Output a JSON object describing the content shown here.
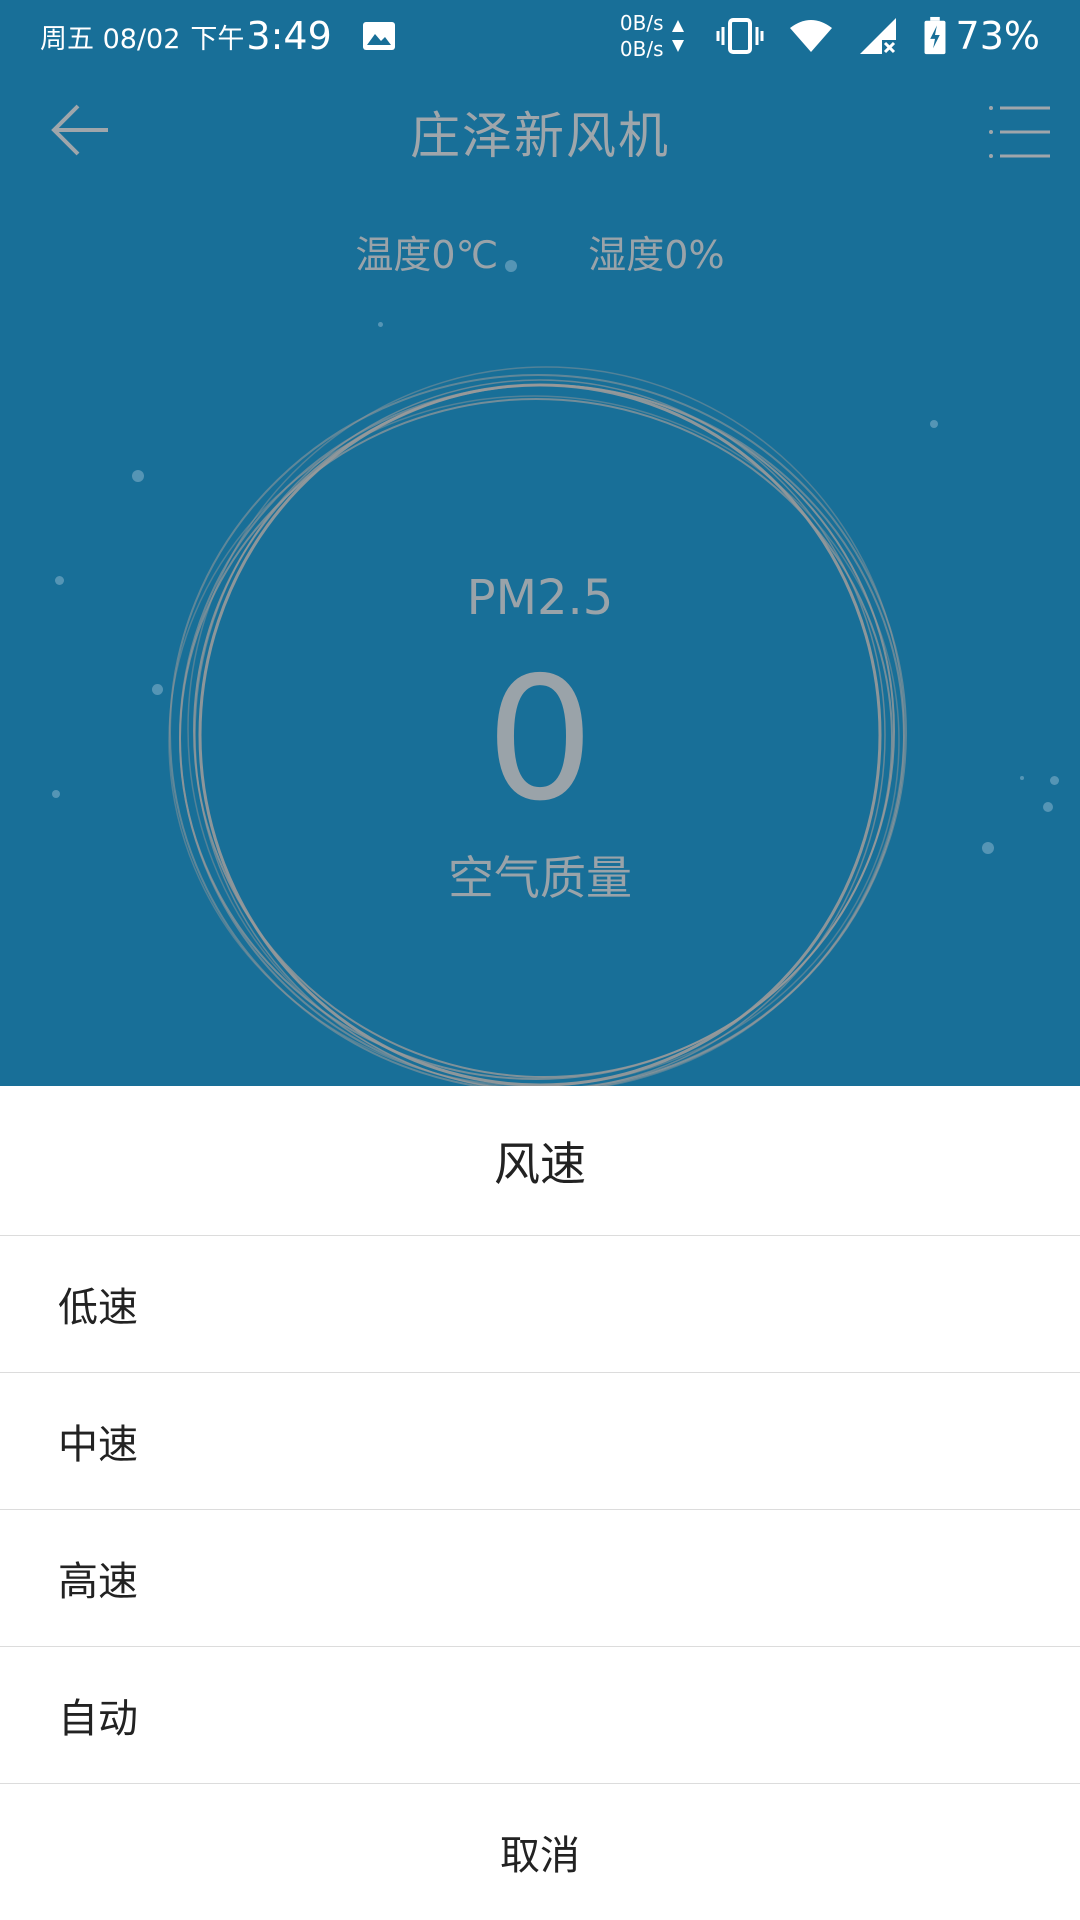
{
  "status_bar": {
    "date": "周五 08/02",
    "period": "下午",
    "time": "3:49",
    "net_up": "0B/s",
    "net_down": "0B/s",
    "battery": "73%",
    "icons": [
      "image-icon",
      "vibrate-icon",
      "wifi-icon",
      "signal-off-icon",
      "battery-charging-icon"
    ]
  },
  "header": {
    "title": "庄泽新风机"
  },
  "environment": {
    "temperature": "温度0℃",
    "humidity": "湿度0%"
  },
  "air": {
    "pm_label": "PM2.5",
    "pm_value": "0",
    "quality_label": "空气质量"
  },
  "sheet": {
    "title": "风速",
    "options": [
      "低速",
      "中速",
      "高速",
      "自动"
    ],
    "cancel": "取消"
  },
  "colors": {
    "background": "#186f98",
    "ring": "#9a9a9a",
    "muted_text": "#9aa3a9"
  }
}
